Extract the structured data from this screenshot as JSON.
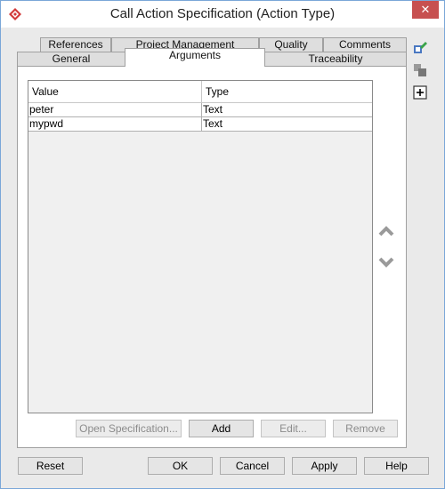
{
  "window": {
    "title": "Call Action Specification (Action Type)",
    "close_glyph": "✕"
  },
  "tabs": {
    "row1": [
      {
        "label": "References"
      },
      {
        "label": "Project Management"
      },
      {
        "label": "Quality"
      },
      {
        "label": "Comments"
      }
    ],
    "row2": [
      {
        "label": "General"
      },
      {
        "label": "Arguments",
        "active": true
      },
      {
        "label": "Traceability"
      }
    ]
  },
  "table": {
    "columns": [
      "Value",
      "Type"
    ],
    "rows": [
      {
        "value": "peter",
        "type": "Text"
      },
      {
        "value": "mypwd",
        "type": "Text"
      }
    ]
  },
  "table_buttons": {
    "open_spec": "Open Specification...",
    "add": "Add",
    "edit": "Edit...",
    "remove": "Remove"
  },
  "footer_buttons": {
    "reset": "Reset",
    "ok": "OK",
    "cancel": "Cancel",
    "apply": "Apply",
    "help": "Help"
  },
  "icons": {
    "app": "visual-paradigm-logo-icon",
    "side1": "edit-model-icon",
    "side2": "merge-icon",
    "side3": "add-box-icon",
    "move_up": "chevron-up-icon",
    "move_down": "chevron-down-icon"
  },
  "colors": {
    "close_red": "#c75050",
    "window_border": "#7aa7d8"
  }
}
